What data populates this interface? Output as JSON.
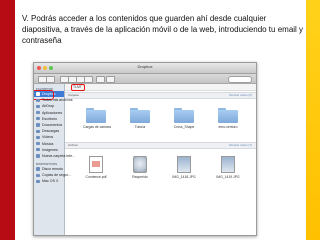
{
  "slide": {
    "caption": "V. Podrás acceder a los contenidos que guarden ahí desde cualquier diapositiva, a través de la aplicación móvil o de la web, introduciendo tu email y contraseña"
  },
  "window": {
    "title": "Dropbox",
    "path_label": "TLMT"
  },
  "sidebar": {
    "sections": [
      {
        "heading": "FAVORITOS",
        "items": [
          {
            "label": "Dropbox",
            "icon": "dropbox-icon",
            "active": true
          },
          {
            "label": "Todos mis archivos",
            "icon": "all-files-icon"
          },
          {
            "label": "AirDrop",
            "icon": "airdrop-icon"
          },
          {
            "label": "Aplicaciones",
            "icon": "applications-icon"
          },
          {
            "label": "Escritorio",
            "icon": "desktop-icon"
          },
          {
            "label": "Documentos",
            "icon": "documents-icon"
          },
          {
            "label": "Descargas",
            "icon": "downloads-icon"
          },
          {
            "label": "Vídeos",
            "icon": "movies-icon"
          },
          {
            "label": "Música",
            "icon": "music-icon"
          },
          {
            "label": "Imágenes",
            "icon": "pictures-icon"
          },
          {
            "label": "Nueva carpeta inte...",
            "icon": "folder-icon"
          }
        ]
      },
      {
        "heading": "DISPOSITIVOS",
        "items": [
          {
            "label": "Disco remoto",
            "icon": "remote-disc-icon"
          },
          {
            "label": "Copias de segur...",
            "icon": "backup-icon"
          },
          {
            "label": "Mac OS X",
            "icon": "disk-icon"
          }
        ]
      }
    ]
  },
  "sections": {
    "top": {
      "name": "Carpeta",
      "more": "Mostrar todos (6)"
    },
    "bottom": {
      "name": "Archivo",
      "more": "Mostrar todos (7)"
    }
  },
  "folders": [
    {
      "label": "Cargas de cámara"
    },
    {
      "label": "Tutoría"
    },
    {
      "label": "Cross_Shape"
    },
    {
      "label": "emo-venturo"
    }
  ],
  "files": [
    {
      "label": "Comience.pdf",
      "kind": "pdf"
    },
    {
      "label": "Requerido",
      "kind": "app"
    },
    {
      "label": "IMG_1418.JPG",
      "kind": "photo"
    },
    {
      "label": "IMG_1419.JPG",
      "kind": "photo"
    }
  ],
  "colors": {
    "left_bar": "#b80c14",
    "right_bar": "#ffc000",
    "highlight": "#e11111",
    "selection": "#3f7ad6"
  }
}
